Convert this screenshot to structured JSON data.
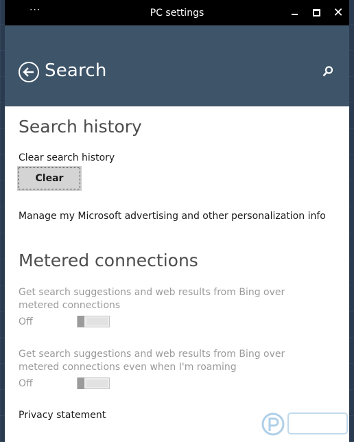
{
  "titlebar": {
    "menu_label": "···",
    "title": "PC settings"
  },
  "header": {
    "page_title": "Search"
  },
  "search_history": {
    "heading": "Search history",
    "clear_label": "Clear search history",
    "clear_button": "Clear",
    "manage_link": "Manage my Microsoft advertising and other personalization info"
  },
  "metered": {
    "heading": "Metered connections",
    "setting1_text": "Get search suggestions and web results from Bing over metered connections",
    "setting1_state": "Off",
    "setting2_text": "Get search suggestions and web results from Bing over metered connections even when I'm roaming",
    "setting2_state": "Off",
    "privacy_link": "Privacy statement"
  },
  "toggles": {
    "setting1_value": 0,
    "setting2_value": 0
  },
  "colors": {
    "titlebar": "#000000",
    "header": "#3e5469",
    "content_bg": "#ffffff",
    "disabled_text": "#9a9a9a"
  }
}
